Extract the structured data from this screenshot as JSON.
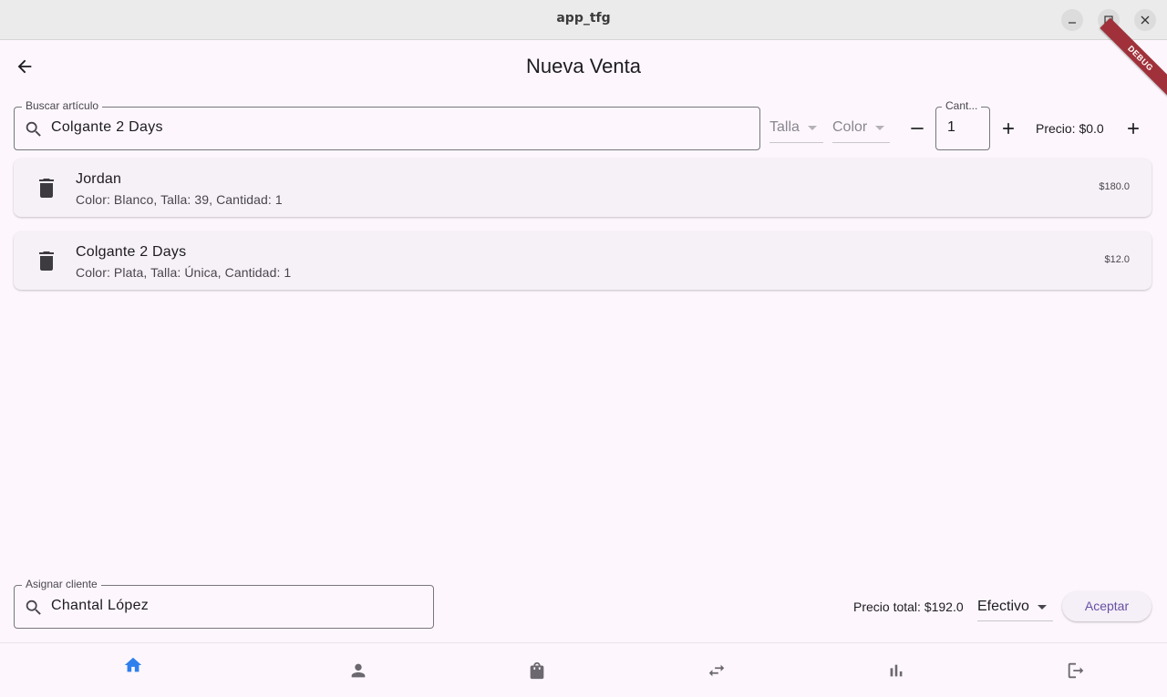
{
  "window": {
    "title": "app_tfg"
  },
  "appbar": {
    "title": "Nueva Venta",
    "debug_label": "DEBUG"
  },
  "search": {
    "label": "Buscar artículo",
    "value": "Colgante 2 Days"
  },
  "filters": {
    "size_label": "Talla",
    "color_label": "Color"
  },
  "quantity": {
    "label": "Cant...",
    "value": "1"
  },
  "price": {
    "text": "Precio: $0.0"
  },
  "items": [
    {
      "name": "Jordan",
      "details": "Color: Blanco, Talla: 39, Cantidad: 1",
      "price": "$180.0"
    },
    {
      "name": "Colgante 2 Days",
      "details": "Color: Plata, Talla: Única, Cantidad: 1",
      "price": "$12.0"
    }
  ],
  "client": {
    "label": "Asignar cliente",
    "value": "Chantal López"
  },
  "footer": {
    "total_text": "Precio total: $192.0",
    "payment_method": "Efectivo",
    "accept_label": "Aceptar"
  },
  "nav": {
    "items": [
      "home-icon",
      "person-icon",
      "shopping-bag-icon",
      "swap-icon",
      "bar-chart-icon",
      "logout-icon"
    ],
    "active_color": "#2f80ed",
    "inactive_color": "#6c6870"
  },
  "colors": {
    "accent": "#6750a4",
    "background": "#fdf7fd",
    "card": "#f6f1f6",
    "debug_ribbon": "#a0313a"
  }
}
